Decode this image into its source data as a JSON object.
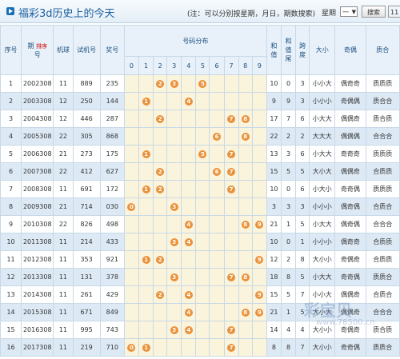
{
  "header": {
    "title": "福彩3d历史上的今天",
    "note": "(注：可以分别按星期，月日，期数搜索)",
    "weekday_label": "星期",
    "weekday_value": "一",
    "search_label": "搜索",
    "extra_value": "11"
  },
  "columns": {
    "seq": "序号",
    "issue_a": "期",
    "issue_b": "号",
    "sort_hint": "排序",
    "machine": "机球",
    "test": "试机号",
    "prize": "奖号",
    "dist": "号码分布",
    "digits": [
      "0",
      "1",
      "2",
      "3",
      "4",
      "5",
      "6",
      "7",
      "8",
      "9"
    ],
    "sum_a": "和",
    "sum_b": "值",
    "tail_a": "和",
    "tail_b": "值",
    "tail_c": "尾",
    "span_a": "跨",
    "span_b": "度",
    "size": "大小",
    "parity": "奇偶",
    "prime": "质合"
  },
  "rows": [
    {
      "seq": "1",
      "issue": "2002308",
      "machine": "11",
      "test": "889",
      "prize": "235",
      "sum": "10",
      "tail": "0",
      "span": "3",
      "size": "小小大",
      "parity": "偶奇奇",
      "prime": "质质质"
    },
    {
      "seq": "2",
      "issue": "2003308",
      "machine": "12",
      "test": "250",
      "prize": "144",
      "sum": "9",
      "tail": "9",
      "span": "3",
      "size": "小小小",
      "parity": "奇偶偶",
      "prime": "质合合"
    },
    {
      "seq": "3",
      "issue": "2004308",
      "machine": "12",
      "test": "446",
      "prize": "287",
      "sum": "17",
      "tail": "7",
      "span": "6",
      "size": "小大大",
      "parity": "偶偶奇",
      "prime": "质合质"
    },
    {
      "seq": "4",
      "issue": "2005308",
      "machine": "22",
      "test": "305",
      "prize": "868",
      "sum": "22",
      "tail": "2",
      "span": "2",
      "size": "大大大",
      "parity": "偶偶偶",
      "prime": "合合合"
    },
    {
      "seq": "5",
      "issue": "2006308",
      "machine": "21",
      "test": "273",
      "prize": "175",
      "sum": "13",
      "tail": "3",
      "span": "6",
      "size": "小大大",
      "parity": "奇奇奇",
      "prime": "质质质"
    },
    {
      "seq": "6",
      "issue": "2007308",
      "machine": "22",
      "test": "412",
      "prize": "627",
      "sum": "15",
      "tail": "5",
      "span": "5",
      "size": "大小大",
      "parity": "偶偶奇",
      "prime": "合质质"
    },
    {
      "seq": "7",
      "issue": "2008308",
      "machine": "11",
      "test": "691",
      "prize": "172",
      "sum": "10",
      "tail": "0",
      "span": "6",
      "size": "小大小",
      "parity": "奇奇偶",
      "prime": "质质质"
    },
    {
      "seq": "8",
      "issue": "2009308",
      "machine": "21",
      "test": "714",
      "prize": "030",
      "sum": "3",
      "tail": "3",
      "span": "3",
      "size": "小小小",
      "parity": "偶奇偶",
      "prime": "合质合"
    },
    {
      "seq": "9",
      "issue": "2010308",
      "machine": "22",
      "test": "826",
      "prize": "498",
      "sum": "21",
      "tail": "1",
      "span": "5",
      "size": "小大大",
      "parity": "偶奇偶",
      "prime": "合合合"
    },
    {
      "seq": "10",
      "issue": "2011308",
      "machine": "11",
      "test": "214",
      "prize": "433",
      "sum": "10",
      "tail": "0",
      "span": "1",
      "size": "小小小",
      "parity": "偶奇奇",
      "prime": "合质质"
    },
    {
      "seq": "11",
      "issue": "2012308",
      "machine": "11",
      "test": "353",
      "prize": "921",
      "sum": "12",
      "tail": "2",
      "span": "8",
      "size": "大小小",
      "parity": "奇偶奇",
      "prime": "合质质"
    },
    {
      "seq": "12",
      "issue": "2013308",
      "machine": "11",
      "test": "131",
      "prize": "378",
      "sum": "18",
      "tail": "8",
      "span": "5",
      "size": "小大大",
      "parity": "奇奇偶",
      "prime": "质质合"
    },
    {
      "seq": "13",
      "issue": "2014308",
      "machine": "11",
      "test": "261",
      "prize": "429",
      "sum": "15",
      "tail": "5",
      "span": "7",
      "size": "小小大",
      "parity": "偶偶奇",
      "prime": "合质合"
    },
    {
      "seq": "14",
      "issue": "2015308",
      "machine": "11",
      "test": "671",
      "prize": "849",
      "sum": "21",
      "tail": "1",
      "span": "5",
      "size": "大小大",
      "parity": "偶偶奇",
      "prime": "合合合"
    },
    {
      "seq": "15",
      "issue": "2016308",
      "machine": "11",
      "test": "995",
      "prize": "743",
      "sum": "14",
      "tail": "4",
      "span": "4",
      "size": "大小小",
      "parity": "奇偶奇",
      "prime": "质合质"
    },
    {
      "seq": "16",
      "issue": "2017308",
      "machine": "11",
      "test": "219",
      "prize": "710",
      "sum": "8",
      "tail": "8",
      "span": "7",
      "size": "大小小",
      "parity": "奇奇偶",
      "prime": "质质合"
    }
  ],
  "watermark": {
    "text": "彩宝贝",
    "url": "www.78500.cn"
  }
}
